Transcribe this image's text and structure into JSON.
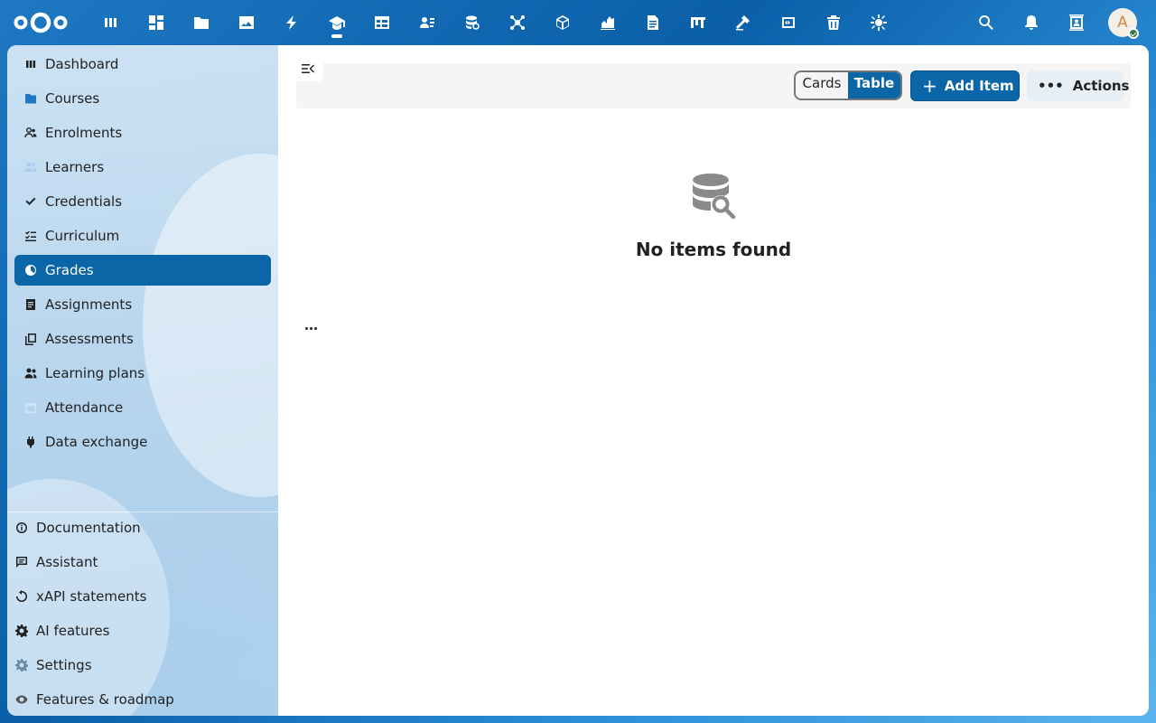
{
  "topbar": {
    "logo": "nextcloud-logo",
    "apps": [
      {
        "name": "dashboard",
        "icon": "dashboard-icon"
      },
      {
        "name": "grid",
        "icon": "grid-icon"
      },
      {
        "name": "files",
        "icon": "folder-icon"
      },
      {
        "name": "photos",
        "icon": "image-icon"
      },
      {
        "name": "activity",
        "icon": "lightning-icon"
      },
      {
        "name": "learning",
        "icon": "graduation-cap-icon",
        "active": true
      },
      {
        "name": "tables",
        "icon": "table-icon"
      },
      {
        "name": "contacts",
        "icon": "contacts-icon"
      },
      {
        "name": "database",
        "icon": "database-icon"
      },
      {
        "name": "network",
        "icon": "network-icon"
      },
      {
        "name": "package",
        "icon": "cube-icon"
      },
      {
        "name": "chart",
        "icon": "chart-icon"
      },
      {
        "name": "document",
        "icon": "document-icon"
      },
      {
        "name": "board",
        "icon": "board-icon"
      },
      {
        "name": "tools",
        "icon": "hammer-icon"
      },
      {
        "name": "code",
        "icon": "code-icon"
      },
      {
        "name": "trash",
        "icon": "trash-icon"
      },
      {
        "name": "settings-app",
        "icon": "gear-bug-icon"
      }
    ],
    "right": [
      "search-icon",
      "bell-icon",
      "contacts-card-icon"
    ],
    "avatar_letter": "A"
  },
  "sidebar": {
    "items": [
      {
        "label": "Dashboard",
        "icon": "dashboard-icon"
      },
      {
        "label": "Courses",
        "icon": "folder-icon"
      },
      {
        "label": "Enrolments",
        "icon": "people-icon"
      },
      {
        "label": "Learners",
        "icon": "users-icon"
      },
      {
        "label": "Credentials",
        "icon": "check-icon"
      },
      {
        "label": "Curriculum",
        "icon": "checklist-icon"
      },
      {
        "label": "Grades",
        "icon": "pie-icon",
        "active": true
      },
      {
        "label": "Assignments",
        "icon": "list-icon"
      },
      {
        "label": "Assessments",
        "icon": "copy-icon"
      },
      {
        "label": "Learning plans",
        "icon": "team-icon"
      },
      {
        "label": "Attendance",
        "icon": "calendar-icon"
      },
      {
        "label": "Data exchange",
        "icon": "plug-icon"
      }
    ],
    "bottom": [
      {
        "label": "Documentation",
        "icon": "info-icon"
      },
      {
        "label": "Assistant",
        "icon": "chat-icon"
      },
      {
        "label": "xAPI statements",
        "icon": "refresh-icon"
      },
      {
        "label": "AI features",
        "icon": "gear-icon"
      },
      {
        "label": "Settings",
        "icon": "cog-icon"
      },
      {
        "label": "Features & roadmap",
        "icon": "eye-icon"
      }
    ]
  },
  "main": {
    "view_options": [
      "Cards",
      "Table"
    ],
    "selected_view": "Table",
    "add_label": "Add Item",
    "actions_label": "Actions",
    "empty_title": "No items found"
  },
  "colors": {
    "primary": "#0b66a8",
    "header_bg": "#0a5fa8",
    "sidebar_bg": "#dbebf8"
  }
}
